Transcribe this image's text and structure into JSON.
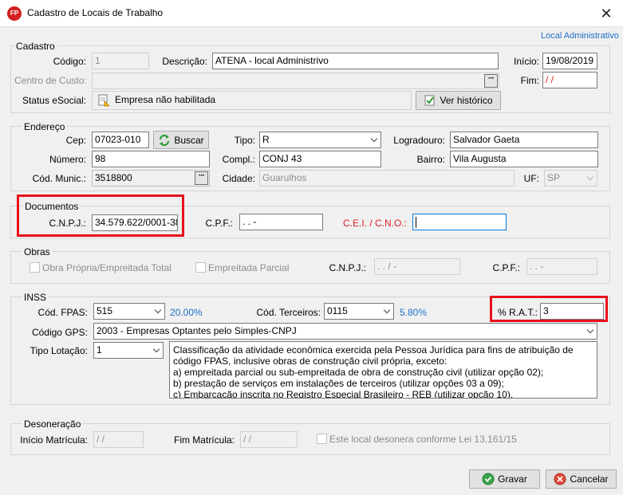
{
  "window": {
    "title": "Cadastro de Locais de Trabalho",
    "app_icon_text": "FP",
    "close_glyph": "✕"
  },
  "header_link": "Local Administrativo",
  "cadastro": {
    "legend": "Cadastro",
    "codigo_label": "Código:",
    "codigo_value": "1",
    "descricao_label": "Descrição:",
    "descricao_value": "ATENA - local Administrivo",
    "inicio_label": "Início:",
    "inicio_value": "19/08/2019",
    "centro_custo_label": "Centro de Custo:",
    "centro_custo_value": "",
    "fim_label": "Fim:",
    "fim_value": " /  /",
    "status_label": "Status eSocial:",
    "status_value": "Empresa não habilitada",
    "historico_button": "Ver histórico"
  },
  "endereco": {
    "legend": "Endereço",
    "cep_label": "Cep:",
    "cep_value": "07023-010",
    "buscar_button": "Buscar",
    "tipo_label": "Tipo:",
    "tipo_value": "R",
    "logradouro_label": "Logradouro:",
    "logradouro_value": "Salvador Gaeta",
    "numero_label": "Número:",
    "numero_value": "98",
    "compl_label": "Compl.:",
    "compl_value": "CONJ 43",
    "bairro_label": "Bairro:",
    "bairro_value": "Vila Augusta",
    "cod_munic_label": "Cód. Munic.:",
    "cod_munic_value": "3518800",
    "cidade_label": "Cidade:",
    "cidade_value": "Guarulhos",
    "uf_label": "UF:",
    "uf_value": "SP"
  },
  "documentos": {
    "legend": "Documentos",
    "cnpj_label": "C.N.P.J.:",
    "cnpj_value": "34.579.622/0001-38",
    "cpf_label": "C.P.F.:",
    "cpf_value": "   .   .    -",
    "cei_label": "C.E.I. / C.N.O.:",
    "cei_value": ""
  },
  "obras": {
    "legend": "Obras",
    "propria_label": "Obra Própria/Empreitada Total",
    "parcial_label": "Empreitada Parcial",
    "cnpj_label": "C.N.P.J.:",
    "cnpj_value": "  .   .   /    -",
    "cpf_label": "C.P.F.:",
    "cpf_value": "   .   .    -"
  },
  "inss": {
    "legend": "INSS",
    "fpas_label": "Cód. FPAS:",
    "fpas_value": "515",
    "fpas_percent": "20.00%",
    "terceiros_label": "Cód. Terceiros:",
    "terceiros_value": "0115",
    "terceiros_percent": "5.80%",
    "rat_label": "% R.A.T.:",
    "rat_value": "3",
    "gps_label": "Código GPS:",
    "gps_value": "2003  - Empresas Optantes pelo Simples-CNPJ",
    "lotacao_label": "Tipo Lotação:",
    "lotacao_value": "1",
    "lotacao_desc": [
      "Classificação da atividade econômica exercida pela Pessoa Jurídica para fins de atribuição de",
      "código FPAS, inclusive obras de construção civil própria, exceto:",
      "a) empreitada parcial ou sub-empreitada de obra de construção civil (utilizar opção 02);",
      "b) prestação de serviços em instalações de terceiros (utilizar opções 03 a 09);",
      "c) Embarcação inscrita no Registro Especial Brasileiro - REB (utilizar opção 10)."
    ]
  },
  "desoneracao": {
    "legend": "Desoneração",
    "inicio_label": "Início Matrícula:",
    "inicio_value": " /  /",
    "fim_label": "Fim Matrícula:",
    "fim_value": " /  /",
    "lei_label": "Este local desonera conforme Lei 13.161/15"
  },
  "footer": {
    "gravar_button": "Gravar",
    "cancelar_button": "Cancelar"
  },
  "colors": {
    "accent_link": "#1e6fc8",
    "required_label": "#e02020",
    "highlight_box": "#e8101a"
  }
}
